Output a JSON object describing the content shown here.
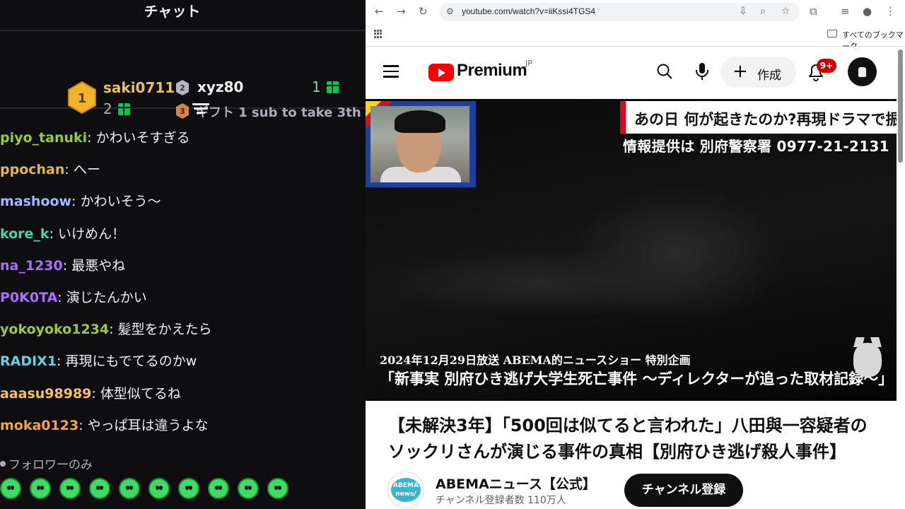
{
  "chat": {
    "title": "チャット",
    "leaderboard": {
      "first": {
        "rank": "1",
        "user": "saki0711",
        "count": "2"
      },
      "second": {
        "rank": "2",
        "user": "xyz80",
        "count": "1"
      },
      "third": {
        "rank": "3",
        "label": "ギフト 1 sub to take 3th"
      }
    },
    "messages": [
      {
        "user": "piyo_tanuki",
        "text": "かわいそすぎる",
        "color": "#9acd32"
      },
      {
        "user": "ppochan",
        "text": "へー",
        "color": "#e6b34a"
      },
      {
        "user": "mashoow",
        "text": "かわいそう〜",
        "color": "#9fb8ff"
      },
      {
        "user": "kore_k",
        "text": "いけめん！",
        "color": "#4fd1a5"
      },
      {
        "user": "na_1230",
        "text": "最悪やね",
        "color": "#a970ff"
      },
      {
        "user": "P0K0TA",
        "text": "演じたんかい",
        "color": "#a970ff"
      },
      {
        "user": "yokoyoko1234",
        "text": "髪型をかえたら",
        "color": "#9acd32"
      },
      {
        "user": "RADIX1",
        "text": "再現にもでてるのかw",
        "color": "#5fd3e8"
      },
      {
        "user": "aaasu98989",
        "text": "体型似てるね",
        "color": "#f5c060"
      },
      {
        "user": "moka0123",
        "text": "やっぱ耳は違うよな",
        "color": "#f5a442"
      }
    ],
    "followers_only": "フォロワーのみ"
  },
  "browser": {
    "url": "youtube.com/watch?v=iiKssi4TGS4",
    "bookmarks_label": "すべてのブックマーク"
  },
  "youtube": {
    "logo_text": "Premium",
    "region": "JP",
    "create_label": "作成",
    "notification_count": "9+",
    "video": {
      "caption_top": "あの日 何が起きたのか?再現ドラマで振り返る",
      "caption_info": "情報提供は 別府警察署 0977-21-2131",
      "caption_broadcast": "2024年12月29日放送 ABEMA的ニュースショー 特別企画",
      "caption_title": "「新事実 別府ひき逃げ大学生死亡事件 〜ディレクターが追った取材記録〜」"
    },
    "title": "【未解決3年】「500回は似てると言われた」八田與一容疑者のソックリさんが演じる事件の真相【別府ひき逃げ殺人事件】",
    "channel": {
      "logo_text": "ABEMA news/",
      "name": "ABEMAニュース【公式】",
      "subscribers": "チャンネル登録者数 110万人",
      "subscribe_label": "チャンネル登録"
    }
  }
}
